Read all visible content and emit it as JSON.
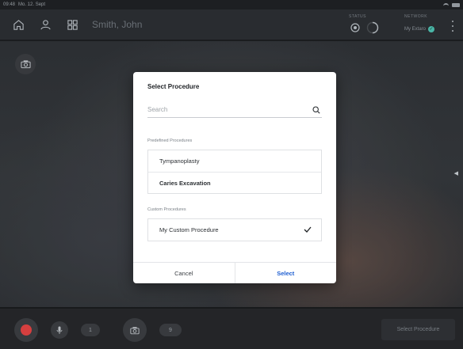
{
  "status_bar": {
    "time": "09:48",
    "date": "Mo. 12. Sept"
  },
  "topbar": {
    "patient_name": "Smith, John",
    "status_label": "STATUS",
    "network_label": "NETWORK",
    "network_value": "My Extaro",
    "icons": [
      "home-icon",
      "person-icon",
      "grid-icon",
      "camera-icon",
      "more-vertical-icon"
    ]
  },
  "dialog": {
    "title": "Select Procedure",
    "search_placeholder": "Search",
    "predefined_caption": "Predefined Procedures",
    "predefined": [
      {
        "label": "Tympanoplasty",
        "selected": false
      },
      {
        "label": "Caries Excavation",
        "selected": true
      }
    ],
    "custom_caption": "Custom Procedures",
    "custom": [
      {
        "label": "My Custom Procedure",
        "checked": true
      }
    ],
    "cancel_label": "Cancel",
    "select_label": "Select"
  },
  "bottombar": {
    "audio_count": "1",
    "photo_count": "9",
    "select_procedure_label": "Select Procedure"
  },
  "colors": {
    "accent": "#1f5fd1",
    "record": "#e24343",
    "network_ok": "#4fc0b0"
  }
}
